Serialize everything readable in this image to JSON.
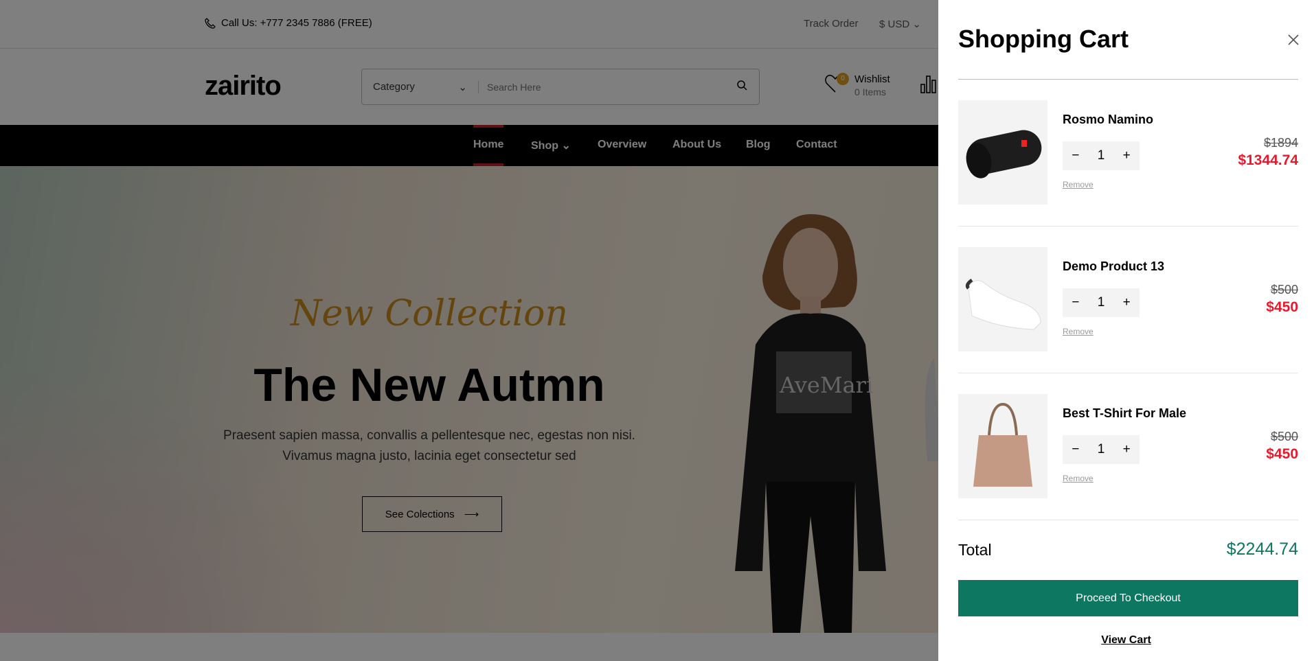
{
  "topbar": {
    "phone": "Call Us: +777 2345 7886 (FREE)",
    "track_order": "Track Order",
    "currency": "$ USD"
  },
  "header": {
    "logo": "zairito",
    "category": "Category",
    "search_placeholder": "Search Here",
    "wishlist_label": "Wishlist",
    "wishlist_count": "0 Items",
    "wishlist_badge": "0"
  },
  "nav": {
    "items": [
      "Home",
      "Shop",
      "Overview",
      "About Us",
      "Blog",
      "Contact"
    ]
  },
  "hero": {
    "script": "New Collection",
    "title": "The New Autmn",
    "para1": "Praesent sapien massa, convallis a pellentesque nec, egestas non nisi.",
    "para2": "Vivamus magna justo, lacinia eget consectetur sed",
    "button": "See Colections",
    "shirt_text": "AveMari"
  },
  "cart": {
    "title": "Shopping Cart",
    "items": [
      {
        "name": "Rosmo Namino",
        "qty": "1",
        "old_price": "$1894",
        "price": "$1344.74",
        "remove": "Remove"
      },
      {
        "name": "Demo Product 13",
        "qty": "1",
        "old_price": "$500",
        "price": "$450",
        "remove": "Remove"
      },
      {
        "name": "Best T-Shirt For Male",
        "qty": "1",
        "old_price": "$500",
        "price": "$450",
        "remove": "Remove"
      }
    ],
    "total_label": "Total",
    "total": "$2244.74",
    "checkout": "Proceed To Checkout",
    "view_cart": "View Cart"
  },
  "colors": {
    "accent": "#0e7761",
    "sale": "#e8192c",
    "nav_active": "#c0202a"
  }
}
